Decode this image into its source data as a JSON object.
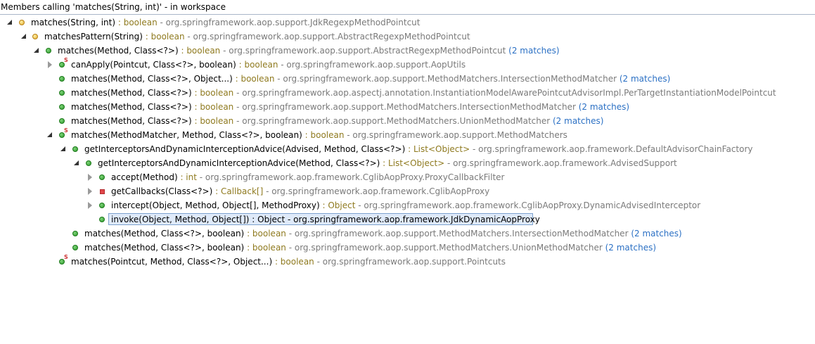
{
  "header": {
    "title": "Members calling 'matches(String, int)' - in workspace"
  },
  "rows": [
    {
      "sig": "matches(String, int)",
      "ret": " : boolean",
      "cls": " - org.springframework.aop.support.JdkRegexpMethodPointcut",
      "cnt": ""
    },
    {
      "sig": "matchesPattern(String)",
      "ret": " : boolean",
      "cls": " - org.springframework.aop.support.AbstractRegexpMethodPointcut",
      "cnt": ""
    },
    {
      "sig": "matches(Method, Class<?>)",
      "ret": " : boolean",
      "cls": " - org.springframework.aop.support.AbstractRegexpMethodPointcut",
      "cnt": " (2 matches)"
    },
    {
      "sig": "canApply(Pointcut, Class<?>, boolean)",
      "ret": " : boolean",
      "cls": " - org.springframework.aop.support.AopUtils",
      "cnt": ""
    },
    {
      "sig": "matches(Method, Class<?>, Object...)",
      "ret": " : boolean",
      "cls": " - org.springframework.aop.support.MethodMatchers.IntersectionMethodMatcher",
      "cnt": " (2 matches)"
    },
    {
      "sig": "matches(Method, Class<?>)",
      "ret": " : boolean",
      "cls": " - org.springframework.aop.aspectj.annotation.InstantiationModelAwarePointcutAdvisorImpl.PerTargetInstantiationModelPointcut",
      "cnt": ""
    },
    {
      "sig": "matches(Method, Class<?>)",
      "ret": " : boolean",
      "cls": " - org.springframework.aop.support.MethodMatchers.IntersectionMethodMatcher",
      "cnt": " (2 matches)"
    },
    {
      "sig": "matches(Method, Class<?>)",
      "ret": " : boolean",
      "cls": " - org.springframework.aop.support.MethodMatchers.UnionMethodMatcher",
      "cnt": " (2 matches)"
    },
    {
      "sig": "matches(MethodMatcher, Method, Class<?>, boolean)",
      "ret": " : boolean",
      "cls": " - org.springframework.aop.support.MethodMatchers",
      "cnt": ""
    },
    {
      "sig": "getInterceptorsAndDynamicInterceptionAdvice(Advised, Method, Class<?>)",
      "ret": " : List<Object>",
      "cls": " - org.springframework.aop.framework.DefaultAdvisorChainFactory",
      "cnt": ""
    },
    {
      "sig": "getInterceptorsAndDynamicInterceptionAdvice(Method, Class<?>)",
      "ret": " : List<Object>",
      "cls": " - org.springframework.aop.framework.AdvisedSupport",
      "cnt": ""
    },
    {
      "sig": "accept(Method)",
      "ret": " : int",
      "cls": " - org.springframework.aop.framework.CglibAopProxy.ProxyCallbackFilter",
      "cnt": ""
    },
    {
      "sig": "getCallbacks(Class<?>)",
      "ret": " : Callback[]",
      "cls": " - org.springframework.aop.framework.CglibAopProxy",
      "cnt": ""
    },
    {
      "sig": "intercept(Object, Method, Object[], MethodProxy)",
      "ret": " : Object",
      "cls": " - org.springframework.aop.framework.CglibAopProxy.DynamicAdvisedInterceptor",
      "cnt": ""
    },
    {
      "sig": "invoke(Object, Method, Object[])",
      "ret": " : Object",
      "cls": " - org.springframework.aop.framework.JdkDynamicAopProxy",
      "cnt": ""
    },
    {
      "sig": "matches(Method, Class<?>, boolean)",
      "ret": " : boolean",
      "cls": " - org.springframework.aop.support.MethodMatchers.IntersectionMethodMatcher",
      "cnt": " (2 matches)"
    },
    {
      "sig": "matches(Method, Class<?>, boolean)",
      "ret": " : boolean",
      "cls": " - org.springframework.aop.support.MethodMatchers.UnionMethodMatcher",
      "cnt": " (2 matches)"
    },
    {
      "sig": "matches(Pointcut, Method, Class<?>, Object...)",
      "ret": " : boolean",
      "cls": " - org.springframework.aop.support.Pointcuts",
      "cnt": ""
    }
  ],
  "static_marker": "S",
  "colors": {
    "return_type": "#8f7a1f",
    "class_name": "#7a7a7a",
    "match_count": "#2b70c4",
    "selection_bg": "#dfeafa",
    "selection_border": "#7da2ce"
  }
}
